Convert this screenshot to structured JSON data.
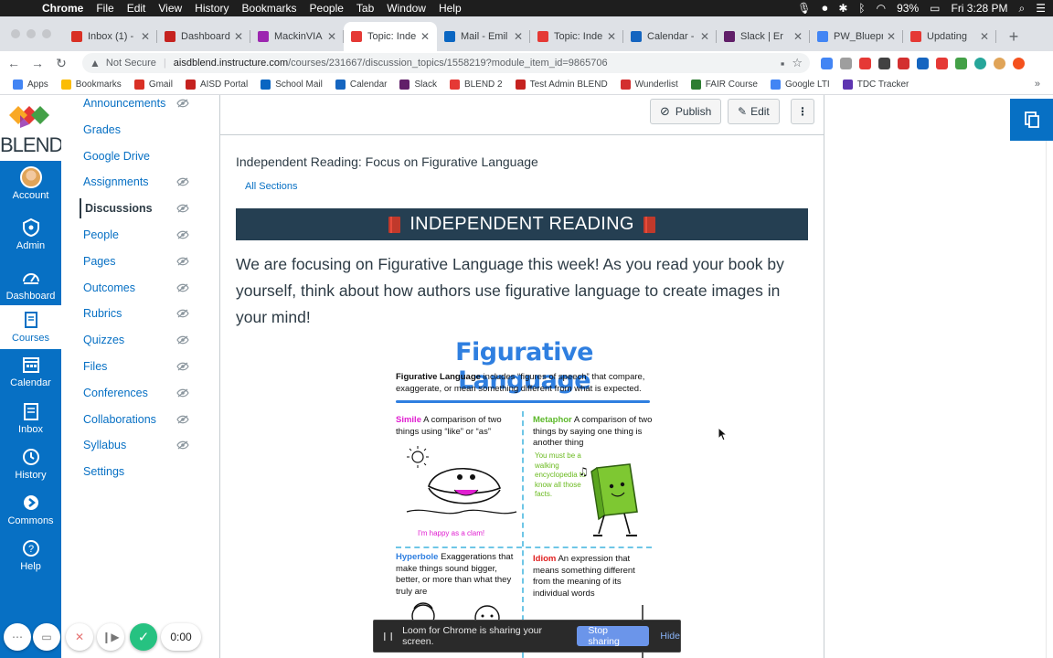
{
  "menubar": {
    "app": "Chrome",
    "items": [
      "File",
      "Edit",
      "View",
      "History",
      "Bookmarks",
      "People",
      "Tab",
      "Window",
      "Help"
    ],
    "battery": "93%",
    "clock": "Fri 3:28 PM"
  },
  "tabs": [
    {
      "title": "Inbox (1) -",
      "color": "#d93025"
    },
    {
      "title": "Dashboard",
      "color": "#c5221f"
    },
    {
      "title": "MackinVIA",
      "color": "#9c27b0"
    },
    {
      "title": "Topic: Inde",
      "color": "#e53935",
      "active": true
    },
    {
      "title": "Mail - Emil",
      "color": "#0a66c2"
    },
    {
      "title": "Topic: Inde",
      "color": "#e53935"
    },
    {
      "title": "Calendar -",
      "color": "#1565c0"
    },
    {
      "title": "Slack | Er",
      "color": "#611f69"
    },
    {
      "title": "PW_Bluepr",
      "color": "#4285f4"
    },
    {
      "title": "Updating",
      "color": "#e53935"
    }
  ],
  "address": {
    "security": "Not Secure",
    "host": "aisdblend.instructure.com",
    "path": "/courses/231667/discussion_topics/1558219?module_item_id=9865706"
  },
  "bookmarks": [
    {
      "label": "Apps",
      "color": "#4285f4"
    },
    {
      "label": "Bookmarks",
      "color": "#fbbc04"
    },
    {
      "label": "Gmail",
      "color": "#d93025"
    },
    {
      "label": "AISD Portal",
      "color": "#c5221f"
    },
    {
      "label": "School Mail",
      "color": "#0a66c2"
    },
    {
      "label": "Calendar",
      "color": "#1565c0"
    },
    {
      "label": "Slack",
      "color": "#611f69"
    },
    {
      "label": "BLEND 2",
      "color": "#e53935"
    },
    {
      "label": "Test Admin BLEND",
      "color": "#c5221f"
    },
    {
      "label": "Wunderlist",
      "color": "#d32f2f"
    },
    {
      "label": "FAIR Course",
      "color": "#2e7d32"
    },
    {
      "label": "Google LTI",
      "color": "#4285f4"
    },
    {
      "label": "TDC Tracker",
      "color": "#5e35b1"
    }
  ],
  "logo_text": "BLEND",
  "global_nav": {
    "account": "Account",
    "admin": "Admin",
    "dashboard": "Dashboard",
    "courses": "Courses",
    "calendar": "Calendar",
    "inbox": "Inbox",
    "history": "History",
    "commons": "Commons",
    "help": "Help"
  },
  "course_nav": [
    {
      "label": "Announcements",
      "hidden": true
    },
    {
      "label": "Grades",
      "hidden": false
    },
    {
      "label": "Google Drive",
      "hidden": false
    },
    {
      "label": "Assignments",
      "hidden": true
    },
    {
      "label": "Discussions",
      "hidden": true,
      "active": true
    },
    {
      "label": "People",
      "hidden": true
    },
    {
      "label": "Pages",
      "hidden": true
    },
    {
      "label": "Outcomes",
      "hidden": true
    },
    {
      "label": "Rubrics",
      "hidden": true
    },
    {
      "label": "Quizzes",
      "hidden": true
    },
    {
      "label": "Files",
      "hidden": true
    },
    {
      "label": "Conferences",
      "hidden": true
    },
    {
      "label": "Collaborations",
      "hidden": true
    },
    {
      "label": "Syllabus",
      "hidden": true
    },
    {
      "label": "Settings",
      "hidden": false
    }
  ],
  "actions": {
    "publish": "Publish",
    "edit": "Edit",
    "more": "⋮"
  },
  "topic": {
    "title": "Independent Reading: Focus on Figurative Language",
    "sections": "All Sections",
    "banner": "INDEPENDENT READING",
    "intro": "We are focusing on Figurative Language this week! As you read your book by yourself, think about how authors use figurative language to create images in your mind!"
  },
  "poster": {
    "title": "Figurative Language",
    "desc_term": "Figurative Language",
    "desc_rest": " includes “figures of speech” that compare, exaggerate, or mean something different from what is expected.",
    "simile_term": "Simile",
    "simile_def": " A comparison of two things using “like” or “as”",
    "simile_example": "I'm happy as a clam!",
    "metaphor_term": "Metaphor",
    "metaphor_def": " A comparison of two things by saying one thing is another thing",
    "metaphor_example": "You must be a walking encyclopedia to know all those facts.",
    "hyperbole_term": "Hyperbole",
    "hyperbole_def": " Exaggerations that make things sound bigger, better, or more than what they truly are",
    "idiom_term": "Idiom",
    "idiom_def": " An expression that means something different from the meaning of its individual words"
  },
  "loom": {
    "timer": "0:00",
    "message": "Loom for Chrome is sharing your screen.",
    "stop": "Stop sharing",
    "hide": "Hide"
  }
}
